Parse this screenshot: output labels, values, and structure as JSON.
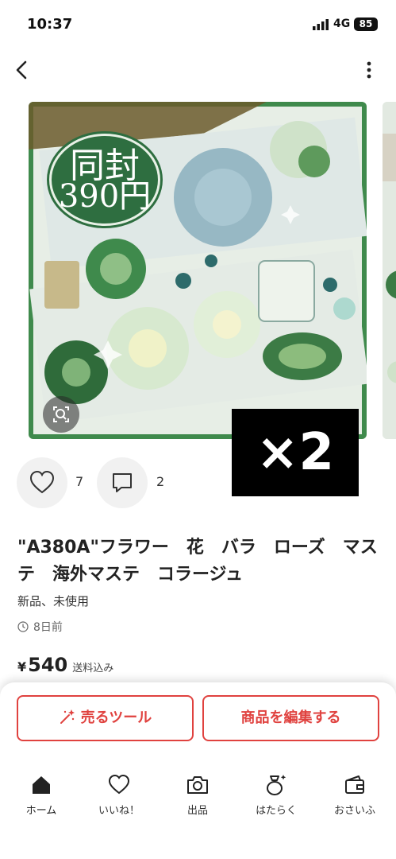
{
  "status_bar": {
    "time": "10:37",
    "network": "4G",
    "battery": "85"
  },
  "item": {
    "title": "\"A380A\"フラワー　花　バラ　ローズ　マステ　海外マステ　コラージュ",
    "condition": "新品、未使用",
    "posted": "8日前",
    "price_currency": "¥",
    "price": "540",
    "shipping": "送料込み",
    "likes": "7",
    "comments": "2"
  },
  "photo": {
    "overlay_line1": "同封",
    "overlay_line2": "390円",
    "quantity_label": "×2"
  },
  "actions": {
    "sell_tool": "売るツール",
    "edit_item": "商品を編集する"
  },
  "tabs": [
    {
      "label": "ホーム",
      "icon": "home-icon",
      "active": true
    },
    {
      "label": "いいね！",
      "icon": "heart-icon"
    },
    {
      "label": "出品",
      "icon": "camera-icon"
    },
    {
      "label": "はたらく",
      "icon": "bag-sparkle-icon"
    },
    {
      "label": "おさいふ",
      "icon": "wallet-icon"
    }
  ],
  "colors": {
    "accent": "#e0423f",
    "photo_green": "#2e6e40"
  }
}
